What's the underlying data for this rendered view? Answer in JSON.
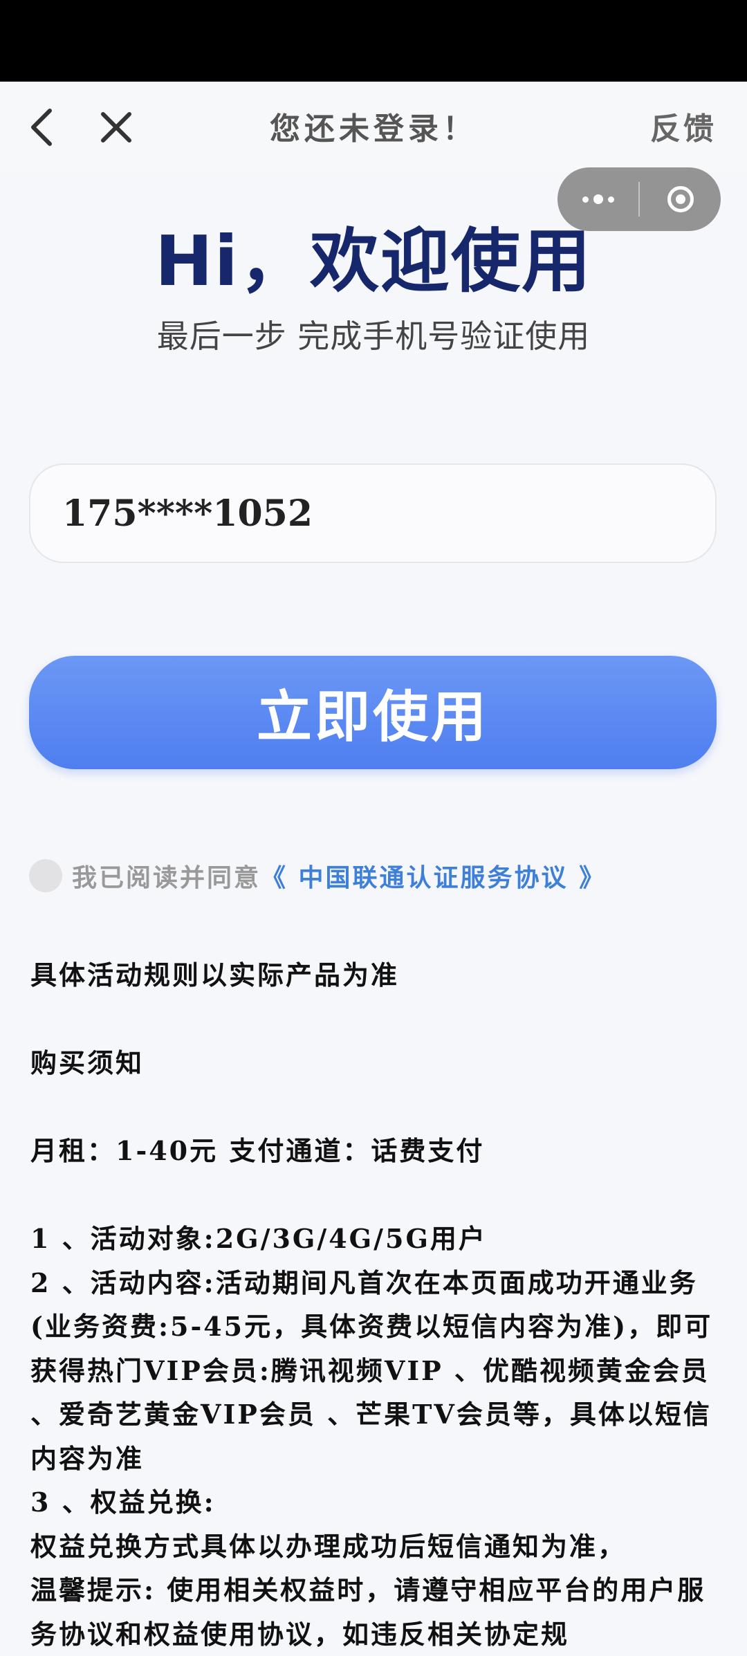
{
  "nav": {
    "title": "您还未登录！",
    "feedback_label": "反馈",
    "back_icon": "chevron-left-icon",
    "close_icon": "close-icon"
  },
  "capsule": {
    "more_icon": "more-dots-icon",
    "exit_icon": "target-circle-icon"
  },
  "hero": {
    "title": "Hi，欢迎使用",
    "subtitle": "最后一步 完成手机号验证使用"
  },
  "phone": {
    "value": "175****1052"
  },
  "cta": {
    "label": "立即使用"
  },
  "agreement": {
    "text": "我已阅读并同意",
    "link": "《 中国联通认证服务协议 》"
  },
  "rules": {
    "line1": "具体活动规则以实际产品为准",
    "line2": "购买须知",
    "line3": "月租：1-40元 支付通道：话费支付",
    "item1": "1 、活动对象:2G/3G/4G/5G用户",
    "item2": "2 、活动内容:活动期间凡首次在本页面成功开通业务(业务资费:5-45元，具体资费以短信内容为准)，即可获得热门VIP会员:腾讯视频VIP 、优酷视频黄金会员 、爱奇艺黄金VIP会员 、芒果TV会员等，具体以短信内容为准",
    "item3_title": "3 、权益兑换:",
    "item3_body": "权益兑换方式具体以办理成功后短信通知为准，",
    "item3_tip": "温馨提示: 使用相关权益时，请遵守相应平台的用户服务协议和权益使用协议，如违反相关协定规"
  },
  "colors": {
    "brand_blue": "#4f7ef0",
    "title_navy": "#16286b",
    "link_blue": "#3d7fd9"
  }
}
